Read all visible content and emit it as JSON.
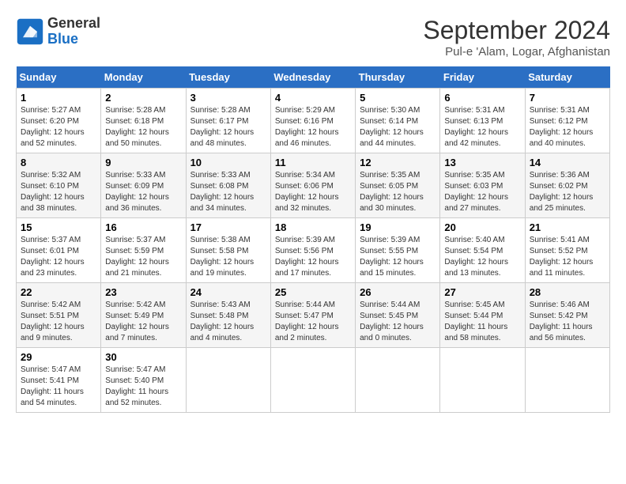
{
  "logo": {
    "line1": "General",
    "line2": "Blue"
  },
  "title": "September 2024",
  "location": "Pul-e 'Alam, Logar, Afghanistan",
  "headers": [
    "Sunday",
    "Monday",
    "Tuesday",
    "Wednesday",
    "Thursday",
    "Friday",
    "Saturday"
  ],
  "weeks": [
    [
      {
        "day": "1",
        "sunrise": "Sunrise: 5:27 AM",
        "sunset": "Sunset: 6:20 PM",
        "daylight": "Daylight: 12 hours and 52 minutes."
      },
      {
        "day": "2",
        "sunrise": "Sunrise: 5:28 AM",
        "sunset": "Sunset: 6:18 PM",
        "daylight": "Daylight: 12 hours and 50 minutes."
      },
      {
        "day": "3",
        "sunrise": "Sunrise: 5:28 AM",
        "sunset": "Sunset: 6:17 PM",
        "daylight": "Daylight: 12 hours and 48 minutes."
      },
      {
        "day": "4",
        "sunrise": "Sunrise: 5:29 AM",
        "sunset": "Sunset: 6:16 PM",
        "daylight": "Daylight: 12 hours and 46 minutes."
      },
      {
        "day": "5",
        "sunrise": "Sunrise: 5:30 AM",
        "sunset": "Sunset: 6:14 PM",
        "daylight": "Daylight: 12 hours and 44 minutes."
      },
      {
        "day": "6",
        "sunrise": "Sunrise: 5:31 AM",
        "sunset": "Sunset: 6:13 PM",
        "daylight": "Daylight: 12 hours and 42 minutes."
      },
      {
        "day": "7",
        "sunrise": "Sunrise: 5:31 AM",
        "sunset": "Sunset: 6:12 PM",
        "daylight": "Daylight: 12 hours and 40 minutes."
      }
    ],
    [
      {
        "day": "8",
        "sunrise": "Sunrise: 5:32 AM",
        "sunset": "Sunset: 6:10 PM",
        "daylight": "Daylight: 12 hours and 38 minutes."
      },
      {
        "day": "9",
        "sunrise": "Sunrise: 5:33 AM",
        "sunset": "Sunset: 6:09 PM",
        "daylight": "Daylight: 12 hours and 36 minutes."
      },
      {
        "day": "10",
        "sunrise": "Sunrise: 5:33 AM",
        "sunset": "Sunset: 6:08 PM",
        "daylight": "Daylight: 12 hours and 34 minutes."
      },
      {
        "day": "11",
        "sunrise": "Sunrise: 5:34 AM",
        "sunset": "Sunset: 6:06 PM",
        "daylight": "Daylight: 12 hours and 32 minutes."
      },
      {
        "day": "12",
        "sunrise": "Sunrise: 5:35 AM",
        "sunset": "Sunset: 6:05 PM",
        "daylight": "Daylight: 12 hours and 30 minutes."
      },
      {
        "day": "13",
        "sunrise": "Sunrise: 5:35 AM",
        "sunset": "Sunset: 6:03 PM",
        "daylight": "Daylight: 12 hours and 27 minutes."
      },
      {
        "day": "14",
        "sunrise": "Sunrise: 5:36 AM",
        "sunset": "Sunset: 6:02 PM",
        "daylight": "Daylight: 12 hours and 25 minutes."
      }
    ],
    [
      {
        "day": "15",
        "sunrise": "Sunrise: 5:37 AM",
        "sunset": "Sunset: 6:01 PM",
        "daylight": "Daylight: 12 hours and 23 minutes."
      },
      {
        "day": "16",
        "sunrise": "Sunrise: 5:37 AM",
        "sunset": "Sunset: 5:59 PM",
        "daylight": "Daylight: 12 hours and 21 minutes."
      },
      {
        "day": "17",
        "sunrise": "Sunrise: 5:38 AM",
        "sunset": "Sunset: 5:58 PM",
        "daylight": "Daylight: 12 hours and 19 minutes."
      },
      {
        "day": "18",
        "sunrise": "Sunrise: 5:39 AM",
        "sunset": "Sunset: 5:56 PM",
        "daylight": "Daylight: 12 hours and 17 minutes."
      },
      {
        "day": "19",
        "sunrise": "Sunrise: 5:39 AM",
        "sunset": "Sunset: 5:55 PM",
        "daylight": "Daylight: 12 hours and 15 minutes."
      },
      {
        "day": "20",
        "sunrise": "Sunrise: 5:40 AM",
        "sunset": "Sunset: 5:54 PM",
        "daylight": "Daylight: 12 hours and 13 minutes."
      },
      {
        "day": "21",
        "sunrise": "Sunrise: 5:41 AM",
        "sunset": "Sunset: 5:52 PM",
        "daylight": "Daylight: 12 hours and 11 minutes."
      }
    ],
    [
      {
        "day": "22",
        "sunrise": "Sunrise: 5:42 AM",
        "sunset": "Sunset: 5:51 PM",
        "daylight": "Daylight: 12 hours and 9 minutes."
      },
      {
        "day": "23",
        "sunrise": "Sunrise: 5:42 AM",
        "sunset": "Sunset: 5:49 PM",
        "daylight": "Daylight: 12 hours and 7 minutes."
      },
      {
        "day": "24",
        "sunrise": "Sunrise: 5:43 AM",
        "sunset": "Sunset: 5:48 PM",
        "daylight": "Daylight: 12 hours and 4 minutes."
      },
      {
        "day": "25",
        "sunrise": "Sunrise: 5:44 AM",
        "sunset": "Sunset: 5:47 PM",
        "daylight": "Daylight: 12 hours and 2 minutes."
      },
      {
        "day": "26",
        "sunrise": "Sunrise: 5:44 AM",
        "sunset": "Sunset: 5:45 PM",
        "daylight": "Daylight: 12 hours and 0 minutes."
      },
      {
        "day": "27",
        "sunrise": "Sunrise: 5:45 AM",
        "sunset": "Sunset: 5:44 PM",
        "daylight": "Daylight: 11 hours and 58 minutes."
      },
      {
        "day": "28",
        "sunrise": "Sunrise: 5:46 AM",
        "sunset": "Sunset: 5:42 PM",
        "daylight": "Daylight: 11 hours and 56 minutes."
      }
    ],
    [
      {
        "day": "29",
        "sunrise": "Sunrise: 5:47 AM",
        "sunset": "Sunset: 5:41 PM",
        "daylight": "Daylight: 11 hours and 54 minutes."
      },
      {
        "day": "30",
        "sunrise": "Sunrise: 5:47 AM",
        "sunset": "Sunset: 5:40 PM",
        "daylight": "Daylight: 11 hours and 52 minutes."
      },
      null,
      null,
      null,
      null,
      null
    ]
  ]
}
